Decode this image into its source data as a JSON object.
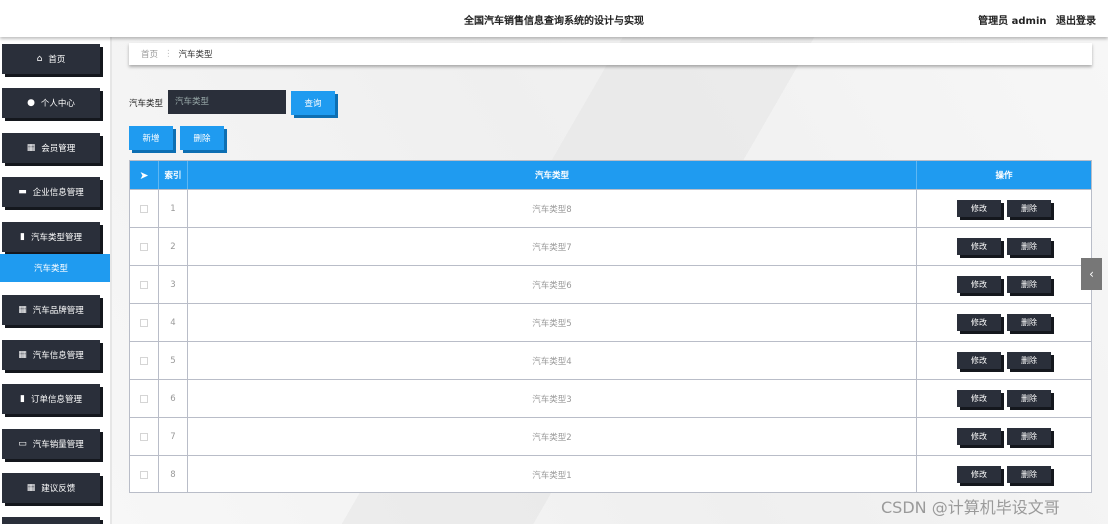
{
  "header": {
    "title": "全国汽车销售信息查询系统的设计与实现",
    "user": "管理员 admin",
    "logout": "退出登录"
  },
  "sidebar": {
    "items": [
      {
        "label": "首页",
        "icon": "home-icon",
        "glyph": "⌂"
      },
      {
        "label": "个人中心",
        "icon": "person-icon",
        "glyph": "●"
      },
      {
        "label": "会员管理",
        "icon": "grid-icon",
        "glyph": "▦"
      },
      {
        "label": "企业信息管理",
        "icon": "briefcase-icon",
        "glyph": "▬"
      },
      {
        "label": "汽车类型管理",
        "icon": "clipboard-icon",
        "glyph": "▮"
      },
      {
        "label": "汽车品牌管理",
        "icon": "grid-icon",
        "glyph": "▦"
      },
      {
        "label": "汽车信息管理",
        "icon": "grid-icon",
        "glyph": "▦"
      },
      {
        "label": "订单信息管理",
        "icon": "bar-chart-icon",
        "glyph": "▮"
      },
      {
        "label": "汽车销量管理",
        "icon": "monitor-icon",
        "glyph": "▭"
      },
      {
        "label": "建议反馈",
        "icon": "grid-icon",
        "glyph": "▦"
      }
    ],
    "active_sub": "汽车类型"
  },
  "breadcrumb": {
    "home": "首页",
    "separator": "⋮",
    "current": "汽车类型"
  },
  "search": {
    "label": "汽车类型",
    "placeholder": "汽车类型",
    "button": "查询"
  },
  "actions": {
    "add": "新增",
    "delete": "删除"
  },
  "table": {
    "headers": {
      "index": "索引",
      "type": "汽车类型",
      "operation": "操作"
    },
    "rows": [
      {
        "index": "1",
        "type": "汽车类型8"
      },
      {
        "index": "2",
        "type": "汽车类型7"
      },
      {
        "index": "3",
        "type": "汽车类型6"
      },
      {
        "index": "4",
        "type": "汽车类型5"
      },
      {
        "index": "5",
        "type": "汽车类型4"
      },
      {
        "index": "6",
        "type": "汽车类型3"
      },
      {
        "index": "7",
        "type": "汽车类型2"
      },
      {
        "index": "8",
        "type": "汽车类型1"
      }
    ],
    "row_actions": {
      "edit": "修改",
      "delete": "删除"
    }
  },
  "colors": {
    "accent": "#1f9bf0",
    "dark": "#2a2f3a"
  },
  "watermark": "CSDN @计算机毕设文哥"
}
